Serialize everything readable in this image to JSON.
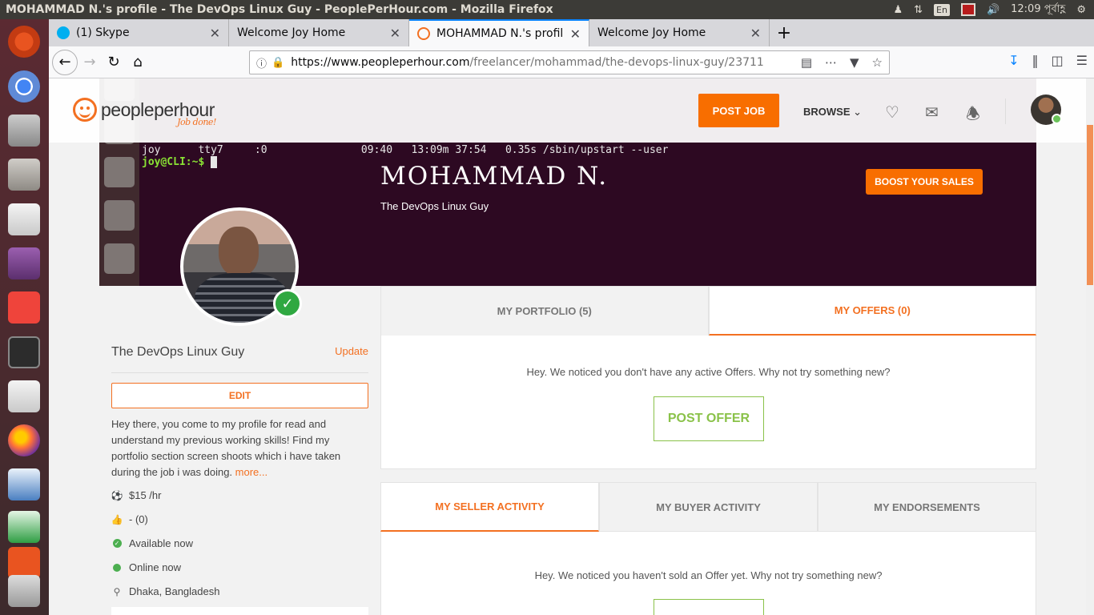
{
  "os": {
    "window_title": "MOHAMMAD N.'s profile - The DevOps Linux Guy - PeoplePerHour.com - Mozilla Firefox",
    "keyboard_layout": "En",
    "clock": "12:09 পূর্বাহ্ণ"
  },
  "browser": {
    "tabs": [
      {
        "label": "(1) Skype",
        "favicon": "skype-icon",
        "active": false
      },
      {
        "label": "Welcome Joy Home",
        "favicon": "none",
        "active": false
      },
      {
        "label": "MOHAMMAD N.'s profil",
        "favicon": "pph-icon",
        "active": true
      },
      {
        "label": "Welcome Joy Home",
        "favicon": "none",
        "active": false
      }
    ],
    "url_host": "https://www.peopleperhour.com",
    "url_path": "/freelancer/mohammad/the-devops-linux-guy/23711"
  },
  "header": {
    "logo_text_bold": "people",
    "logo_text_regular": "perhour",
    "logo_tagline": "Job done!",
    "post_job": "POST JOB",
    "browse": "BROWSE"
  },
  "cover": {
    "terminal_line_1": "joy      tty7     :0               09:40   13:09m 37:54   0.35s /sbin/upstart --user",
    "terminal_prompt": "joy@CLI:~$ ",
    "name": "MOHAMMAD N.",
    "tagline": "The DevOps Linux Guy",
    "boost": "BOOST YOUR SALES"
  },
  "profile": {
    "headline": "The DevOps Linux Guy",
    "update": "Update",
    "edit": "EDIT",
    "about": "Hey there, you come to my profile for read and understand my previous working skills! Find my portfolio section screen shoots which i have taken during the job i was doing.",
    "more": "more...",
    "rate": "$15 /hr",
    "rating": "- (0)",
    "availability": "Available now",
    "status": "Online now",
    "location": "Dhaka, Bangladesh"
  },
  "portfolio_tabs": [
    {
      "label": "MY PORTFOLIO (5)",
      "active": false
    },
    {
      "label": "MY OFFERS (0)",
      "active": true
    }
  ],
  "offers": {
    "notice": "Hey. We noticed you don't have any active Offers. Why not try something new?",
    "button": "POST OFFER"
  },
  "activity_tabs": [
    {
      "label": "MY SELLER ACTIVITY",
      "active": true
    },
    {
      "label": "MY BUYER ACTIVITY",
      "active": false
    },
    {
      "label": "MY ENDORSEMENTS",
      "active": false
    }
  ],
  "activity": {
    "notice": "Hey. We noticed you haven't sold an Offer yet. Why not try something new?"
  },
  "colors": {
    "brand_orange": "#f86e00",
    "offer_green": "#8ac249",
    "online_green": "#4caf50"
  }
}
